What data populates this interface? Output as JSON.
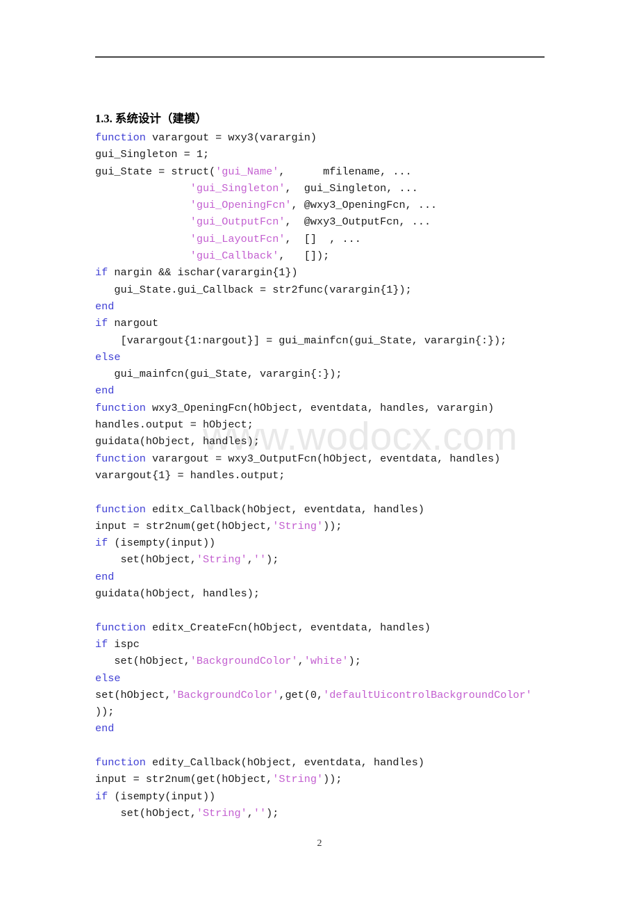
{
  "document": {
    "page_number": "2",
    "watermark": "www.wodocx.com",
    "heading": "1.3. 系统设计（建模）"
  },
  "colors": {
    "keyword": "#3f3fd4",
    "string": "#c35fd0",
    "plain": "#1a1a1a",
    "rule": "#444444",
    "watermark": "#e9e9e9"
  },
  "code": {
    "language": "MATLAB",
    "lines": [
      [
        {
          "t": "kw",
          "s": "function"
        },
        {
          "t": "plain",
          "s": " varargout = wxy3(varargin)"
        }
      ],
      [
        {
          "t": "plain",
          "s": "gui_Singleton = 1;"
        }
      ],
      [
        {
          "t": "plain",
          "s": "gui_State = struct("
        },
        {
          "t": "str",
          "s": "'gui_Name'"
        },
        {
          "t": "plain",
          "s": ",      mfilename, ..."
        }
      ],
      [
        {
          "t": "plain",
          "s": "               "
        },
        {
          "t": "str",
          "s": "'gui_Singleton'"
        },
        {
          "t": "plain",
          "s": ",  gui_Singleton, ..."
        }
      ],
      [
        {
          "t": "plain",
          "s": "               "
        },
        {
          "t": "str",
          "s": "'gui_OpeningFcn'"
        },
        {
          "t": "plain",
          "s": ", @wxy3_OpeningFcn, ..."
        }
      ],
      [
        {
          "t": "plain",
          "s": "               "
        },
        {
          "t": "str",
          "s": "'gui_OutputFcn'"
        },
        {
          "t": "plain",
          "s": ",  @wxy3_OutputFcn, ..."
        }
      ],
      [
        {
          "t": "plain",
          "s": "               "
        },
        {
          "t": "str",
          "s": "'gui_LayoutFcn'"
        },
        {
          "t": "plain",
          "s": ",  []  , ..."
        }
      ],
      [
        {
          "t": "plain",
          "s": "               "
        },
        {
          "t": "str",
          "s": "'gui_Callback'"
        },
        {
          "t": "plain",
          "s": ",   []);"
        }
      ],
      [
        {
          "t": "kw",
          "s": "if"
        },
        {
          "t": "plain",
          "s": " nargin && ischar(varargin{1})"
        }
      ],
      [
        {
          "t": "plain",
          "s": "   gui_State.gui_Callback = str2func(varargin{1});"
        }
      ],
      [
        {
          "t": "kw",
          "s": "end"
        }
      ],
      [
        {
          "t": "kw",
          "s": "if"
        },
        {
          "t": "plain",
          "s": " nargout"
        }
      ],
      [
        {
          "t": "plain",
          "s": "    [varargout{1:nargout}] = gui_mainfcn(gui_State, varargin{:});"
        }
      ],
      [
        {
          "t": "kw",
          "s": "else"
        }
      ],
      [
        {
          "t": "plain",
          "s": "   gui_mainfcn(gui_State, varargin{:});"
        }
      ],
      [
        {
          "t": "kw",
          "s": "end"
        }
      ],
      [
        {
          "t": "kw",
          "s": "function"
        },
        {
          "t": "plain",
          "s": " wxy3_OpeningFcn(hObject, eventdata, handles, varargin)"
        }
      ],
      [
        {
          "t": "plain",
          "s": "handles.output = hObject;"
        }
      ],
      [
        {
          "t": "plain",
          "s": "guidata(hObject, handles);"
        }
      ],
      [
        {
          "t": "kw",
          "s": "function"
        },
        {
          "t": "plain",
          "s": " varargout = wxy3_OutputFcn(hObject, eventdata, handles)"
        }
      ],
      [
        {
          "t": "plain",
          "s": "varargout{1} = handles.output;"
        }
      ],
      [],
      [
        {
          "t": "kw",
          "s": "function"
        },
        {
          "t": "plain",
          "s": " editx_Callback(hObject, eventdata, handles)"
        }
      ],
      [
        {
          "t": "plain",
          "s": "input = str2num(get(hObject,"
        },
        {
          "t": "str",
          "s": "'String'"
        },
        {
          "t": "plain",
          "s": "));"
        }
      ],
      [
        {
          "t": "kw",
          "s": "if"
        },
        {
          "t": "plain",
          "s": " (isempty(input))"
        }
      ],
      [
        {
          "t": "plain",
          "s": "    set(hObject,"
        },
        {
          "t": "str",
          "s": "'String'"
        },
        {
          "t": "plain",
          "s": ","
        },
        {
          "t": "str",
          "s": "''"
        },
        {
          "t": "plain",
          "s": ");"
        }
      ],
      [
        {
          "t": "kw",
          "s": "end"
        }
      ],
      [
        {
          "t": "plain",
          "s": "guidata(hObject, handles);"
        }
      ],
      [],
      [
        {
          "t": "kw",
          "s": "function"
        },
        {
          "t": "plain",
          "s": " editx_CreateFcn(hObject, eventdata, handles)"
        }
      ],
      [
        {
          "t": "kw",
          "s": "if"
        },
        {
          "t": "plain",
          "s": " ispc"
        }
      ],
      [
        {
          "t": "plain",
          "s": "   set(hObject,"
        },
        {
          "t": "str",
          "s": "'BackgroundColor'"
        },
        {
          "t": "plain",
          "s": ","
        },
        {
          "t": "str",
          "s": "'white'"
        },
        {
          "t": "plain",
          "s": ");"
        }
      ],
      [
        {
          "t": "kw",
          "s": "else"
        }
      ],
      [
        {
          "t": "plain",
          "s": "set(hObject,"
        },
        {
          "t": "str",
          "s": "'BackgroundColor'"
        },
        {
          "t": "plain",
          "s": ",get(0,"
        },
        {
          "t": "str",
          "s": "'defaultUicontrolBackgroundColor'"
        }
      ],
      [
        {
          "t": "plain",
          "s": "));"
        }
      ],
      [
        {
          "t": "kw",
          "s": "end"
        }
      ],
      [],
      [
        {
          "t": "kw",
          "s": "function"
        },
        {
          "t": "plain",
          "s": " edity_Callback(hObject, eventdata, handles)"
        }
      ],
      [
        {
          "t": "plain",
          "s": "input = str2num(get(hObject,"
        },
        {
          "t": "str",
          "s": "'String'"
        },
        {
          "t": "plain",
          "s": "));"
        }
      ],
      [
        {
          "t": "kw",
          "s": "if"
        },
        {
          "t": "plain",
          "s": " (isempty(input))"
        }
      ],
      [
        {
          "t": "plain",
          "s": "    set(hObject,"
        },
        {
          "t": "str",
          "s": "'String'"
        },
        {
          "t": "plain",
          "s": ","
        },
        {
          "t": "str",
          "s": "''"
        },
        {
          "t": "plain",
          "s": ");"
        }
      ]
    ]
  }
}
